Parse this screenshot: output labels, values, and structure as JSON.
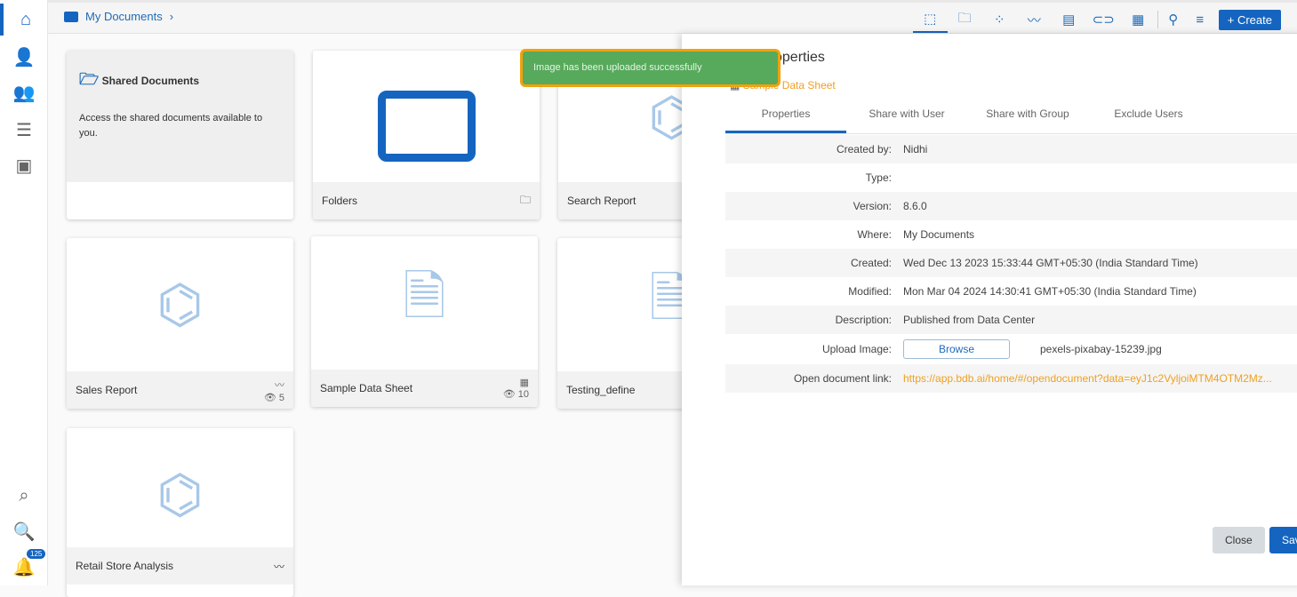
{
  "sidebar": {
    "items": [
      "home-icon",
      "user-settings-icon",
      "users-group-icon",
      "database-network-icon",
      "presentation-user-icon",
      "data-search-icon",
      "search-database-icon",
      "bell-icon"
    ],
    "notifications": "125"
  },
  "header": {
    "breadcrumb": "My Documents",
    "create_label": "Create"
  },
  "cards": [
    {
      "title": "Shared Documents",
      "description": "Access the shared documents available to you."
    },
    {
      "title": "Folders"
    },
    {
      "title": "Search Report"
    },
    {
      "title": "Sales Report",
      "views": "5"
    },
    {
      "title": "Sample Data Sheet",
      "views": "10"
    },
    {
      "title": "Testing_define"
    },
    {
      "title": "Retail Store Analysis"
    }
  ],
  "panel": {
    "title": "Properties",
    "subtitle": "Sample Data Sheet",
    "tabs": [
      "Properties",
      "Share with User",
      "Share with Group",
      "Exclude Users"
    ],
    "rows": [
      {
        "label": "Created by:",
        "value": "Nidhi"
      },
      {
        "label": "Type:",
        "value": ""
      },
      {
        "label": "Version:",
        "value": "8.6.0"
      },
      {
        "label": "Where:",
        "value": "My Documents"
      },
      {
        "label": "Created:",
        "value": "Wed Dec 13 2023 15:33:44 GMT+05:30 (India Standard Time)"
      },
      {
        "label": "Modified:",
        "value": "Mon Mar 04 2024 14:30:41 GMT+05:30 (India Standard Time)"
      },
      {
        "label": "Description:",
        "value": "Published from Data Center"
      }
    ],
    "upload_label": "Upload Image:",
    "browse_label": "Browse",
    "file_name": "pexels-pixabay-15239.jpg",
    "link_label": "Open document link:",
    "link": "https://app.bdb.ai/home/#/opendocument?data=eyJ1c2VyljoiMTM4OTM2Mz...",
    "close_label": "Close",
    "save_label": "Save"
  },
  "toast": "Image has been uploaded successfully"
}
